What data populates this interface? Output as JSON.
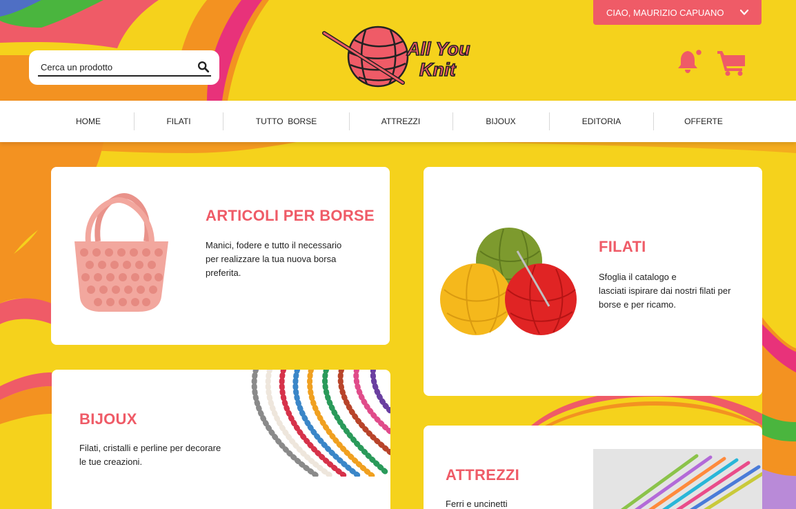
{
  "header": {
    "search": {
      "placeholder": "Cerca un prodotto"
    },
    "logo": {
      "text_line1": "All You",
      "text_line2": "Knit"
    },
    "user_menu": {
      "label": "CIAO, MAURIZIO CAPUANO"
    },
    "icons": [
      "search-icon",
      "bell-icon",
      "cart-icon",
      "chevron-down-icon"
    ],
    "notification_dot_color": "#ef5b67"
  },
  "nav": {
    "items": [
      {
        "label": "HOME"
      },
      {
        "label": "FILATI"
      },
      {
        "label": "TUTTO  BORSE"
      },
      {
        "label": "ATTREZZI"
      },
      {
        "label": "BIJOUX"
      },
      {
        "label": "EDITORIA"
      },
      {
        "label": "OFFERTE"
      }
    ]
  },
  "cards": {
    "borse": {
      "title": "ARTICOLI PER BORSE",
      "desc_lines": [
        "Manici, fodere e tutto il necessario",
        "per realizzare la tua nuova borsa",
        "preferita."
      ]
    },
    "filati": {
      "title": "FILATI",
      "desc_lines": [
        "Sfoglia il catalogo e",
        "lasciati ispirare dai nostri filati per",
        "borse e per ricamo."
      ]
    },
    "bijoux": {
      "title": "BIJOUX",
      "desc_lines": [
        "Filati, cristalli e perline per decorare",
        "le tue creazioni."
      ]
    },
    "attrezzi": {
      "title": "ATTREZZI",
      "desc_lines": [
        "Ferri e uncinetti"
      ]
    }
  },
  "colors": {
    "background": "#f5d21c",
    "accent": "#ef5b67",
    "nav_background": "#ffffff"
  }
}
